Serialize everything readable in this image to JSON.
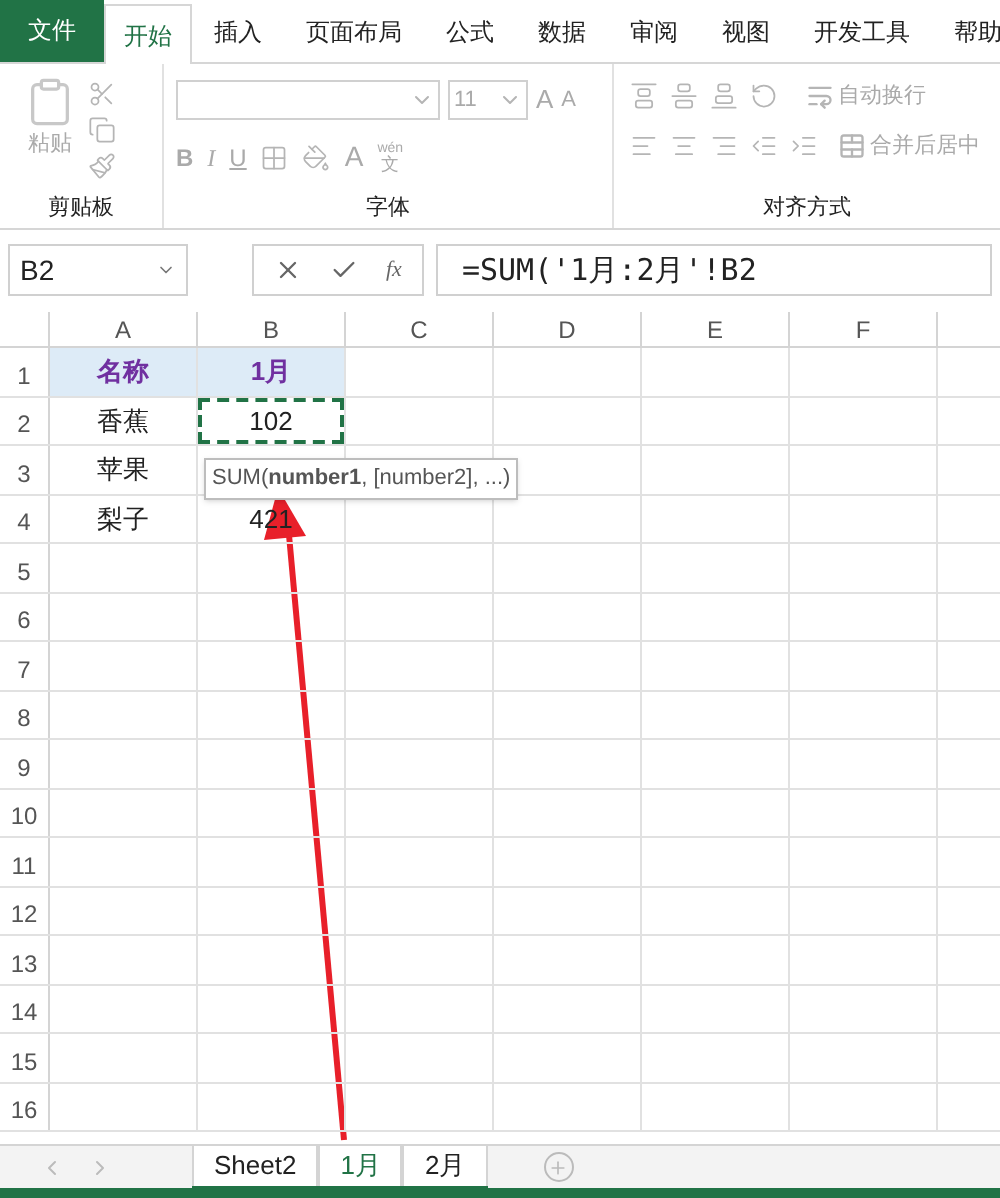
{
  "ribbon_tabs": [
    {
      "label": "文件",
      "kind": "file",
      "selected": false
    },
    {
      "label": "开始",
      "kind": "tab",
      "selected": true
    },
    {
      "label": "插入",
      "kind": "tab",
      "selected": false
    },
    {
      "label": "页面布局",
      "kind": "tab",
      "selected": false
    },
    {
      "label": "公式",
      "kind": "tab",
      "selected": false
    },
    {
      "label": "数据",
      "kind": "tab",
      "selected": false
    },
    {
      "label": "审阅",
      "kind": "tab",
      "selected": false
    },
    {
      "label": "视图",
      "kind": "tab",
      "selected": false
    },
    {
      "label": "开发工具",
      "kind": "tab",
      "selected": false
    },
    {
      "label": "帮助",
      "kind": "tab",
      "selected": false
    }
  ],
  "clipboard": {
    "paste": "粘贴",
    "label": "剪贴板"
  },
  "font": {
    "size": "11",
    "grow": "A",
    "shrink": "A",
    "bold": "B",
    "italic": "I",
    "underline": "U",
    "font_color": "A",
    "phonetic_top": "wén",
    "phonetic_bottom": "文",
    "label": "字体"
  },
  "alignment": {
    "wrap": "自动换行",
    "merge": "合并后居中",
    "label": "对齐方式"
  },
  "formula_bar": {
    "name_box": "B2",
    "fx": "fx",
    "formula": "=SUM('1月:2月'!B2"
  },
  "columns": [
    "A",
    "B",
    "C",
    "D",
    "E",
    "F"
  ],
  "rows": [
    {
      "number": "1",
      "kind": "header",
      "cells": [
        {
          "text": "名称",
          "marquee": false
        },
        {
          "text": "1月",
          "marquee": false
        }
      ]
    },
    {
      "number": "2",
      "kind": "data",
      "cells": [
        {
          "text": "香蕉",
          "marquee": false
        },
        {
          "text": "102",
          "marquee": true
        }
      ]
    },
    {
      "number": "3",
      "kind": "data",
      "cells": [
        {
          "text": "苹果",
          "marquee": false
        },
        {
          "text": "",
          "marquee": false
        }
      ]
    },
    {
      "number": "4",
      "kind": "data",
      "cells": [
        {
          "text": "梨子",
          "marquee": false
        },
        {
          "text": "421",
          "marquee": false
        }
      ]
    },
    {
      "number": "5"
    },
    {
      "number": "6"
    },
    {
      "number": "7"
    },
    {
      "number": "8"
    },
    {
      "number": "9"
    },
    {
      "number": "10"
    },
    {
      "number": "11"
    },
    {
      "number": "12"
    },
    {
      "number": "13"
    },
    {
      "number": "14"
    },
    {
      "number": "15"
    },
    {
      "number": "16"
    }
  ],
  "tooltip": "SUM(**number1**, [number2], ...)",
  "sheet_tabs": [
    {
      "label": "Sheet2",
      "selected": false
    },
    {
      "label": "1月",
      "selected": true
    },
    {
      "label": "2月",
      "selected": false
    }
  ]
}
